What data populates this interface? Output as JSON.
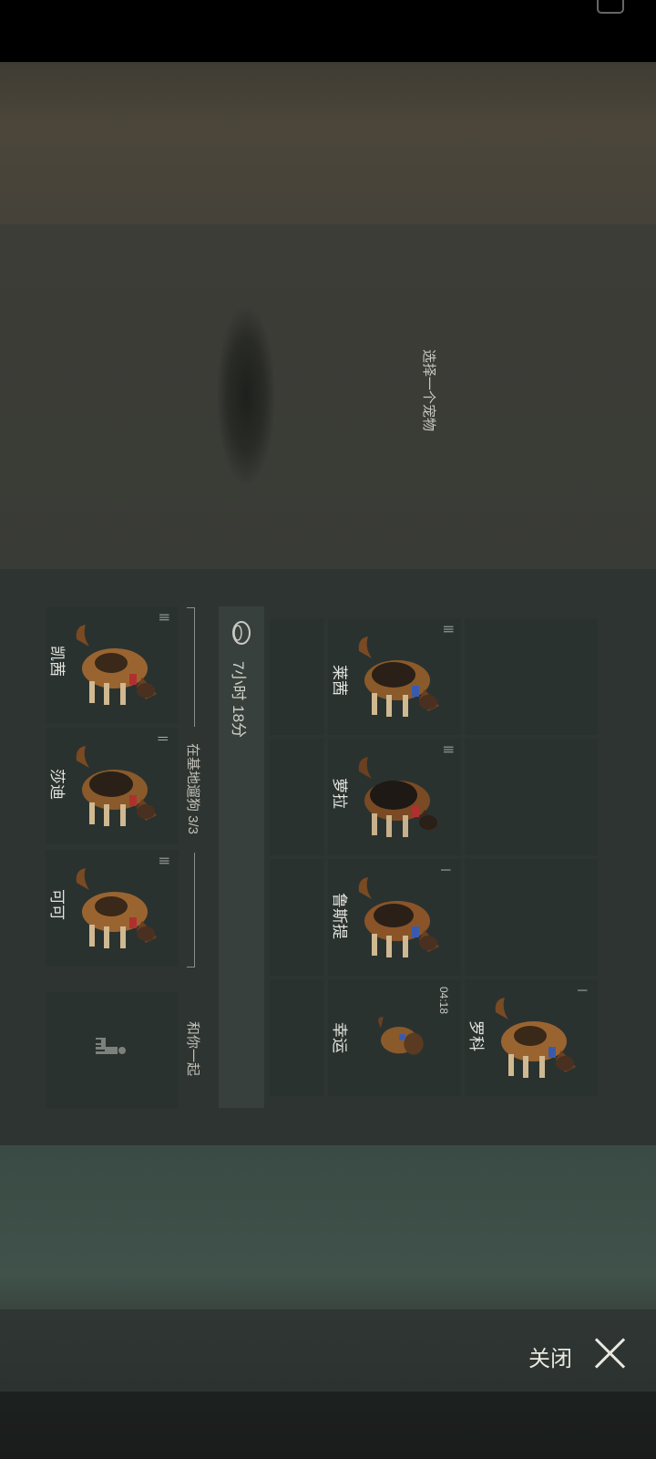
{
  "dialog": {
    "title": "选择一个宠物"
  },
  "timer": {
    "label": "7小时 18分"
  },
  "sections": {
    "base_dogs": "在基地遛狗 3/3",
    "with_you": "和你一起"
  },
  "pets": [
    {
      "name": "莱茜"
    },
    {
      "name": "萝拉"
    },
    {
      "name": "鲁斯提"
    },
    {
      "name": "幸运",
      "time": "04:18"
    },
    {
      "name": "罗科"
    },
    {
      "name": "凯茜"
    },
    {
      "name": "莎迪"
    },
    {
      "name": "可可"
    }
  ],
  "close": {
    "label": "关闭"
  },
  "icons": {
    "timer": "bowl-icon",
    "menu": "menu-lines-icon",
    "with_you": "person-with-dog-icon",
    "close": "close-icon"
  },
  "colors": {
    "card": "#2a3230",
    "panel": "#2e3431",
    "text": "#c9c9c2"
  }
}
